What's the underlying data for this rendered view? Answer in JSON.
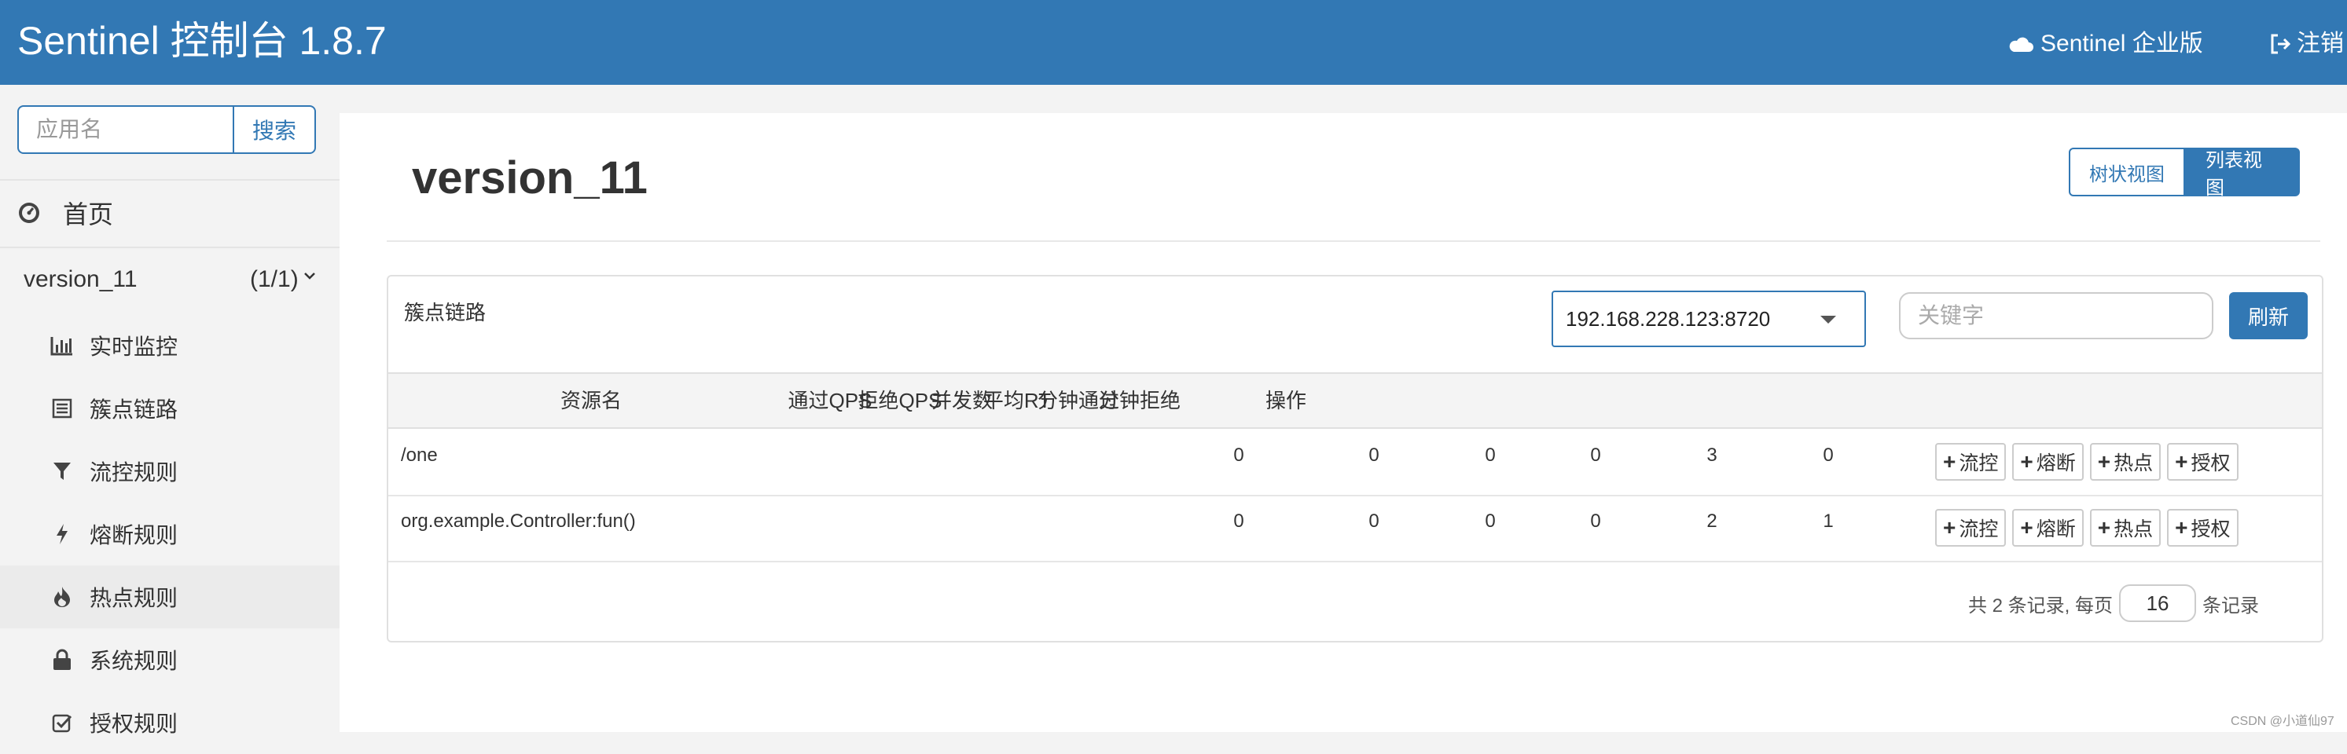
{
  "header": {
    "brand": "Sentinel 控制台 1.8.7",
    "enterprise_link": "Sentinel 企业版",
    "logout": "注销"
  },
  "sidebar": {
    "search_placeholder": "应用名",
    "search_button": "搜索",
    "home": "首页",
    "app": {
      "name": "version_11",
      "count": "(1/1)"
    },
    "menu": [
      {
        "label": "实时监控",
        "icon": "bar-chart-icon"
      },
      {
        "label": "簇点链路",
        "icon": "list-icon"
      },
      {
        "label": "流控规则",
        "icon": "filter-icon"
      },
      {
        "label": "熔断规则",
        "icon": "lightning-icon"
      },
      {
        "label": "热点规则",
        "icon": "fire-icon"
      },
      {
        "label": "系统规则",
        "icon": "lock-icon"
      },
      {
        "label": "授权规则",
        "icon": "check-square-icon"
      }
    ]
  },
  "main": {
    "title": "version_11",
    "view_tree": "树状视图",
    "view_list": "列表视图",
    "card_title": "簇点链路",
    "machine": "192.168.228.123:8720",
    "keyword_placeholder": "关键字",
    "refresh": "刷新",
    "columns": [
      "资源名",
      "通过QPS",
      "拒绝QPS",
      "并发数",
      "平均RT",
      "分钟通过",
      "分钟拒绝",
      "操作"
    ],
    "rows": [
      {
        "resource": "/one",
        "pass_qps": "0",
        "block_qps": "0",
        "concurrency": "0",
        "avg_rt": "0",
        "min_pass": "3",
        "min_block": "0"
      },
      {
        "resource": "org.example.Controller:fun()",
        "pass_qps": "0",
        "block_qps": "0",
        "concurrency": "0",
        "avg_rt": "0",
        "min_pass": "2",
        "min_block": "1"
      }
    ],
    "actions": [
      "流控",
      "熔断",
      "热点",
      "授权"
    ],
    "pager": {
      "prefix": "共 2 条记录, 每页",
      "page_size": "16",
      "suffix": "条记录"
    }
  },
  "watermark": "CSDN @小道仙97",
  "colors": {
    "primary": "#3278b4"
  }
}
